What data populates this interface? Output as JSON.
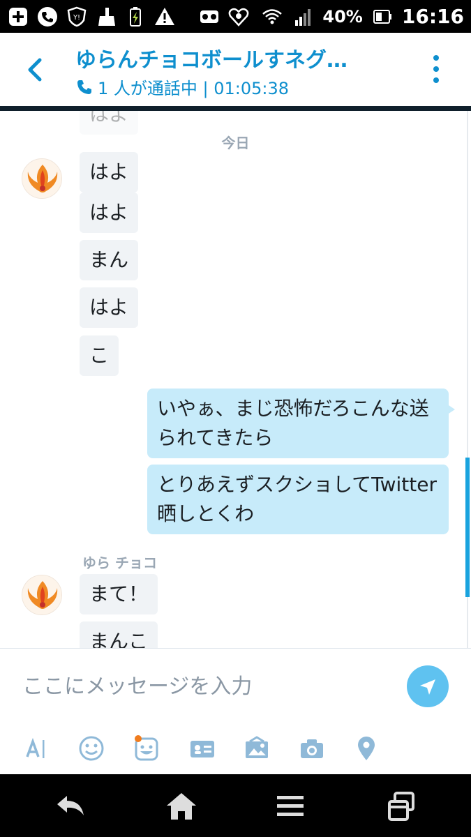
{
  "status_bar": {
    "battery_percent": "40%",
    "time": "16:16",
    "icons": [
      "plus-icon",
      "phone-icon",
      "yahoo-shield-icon",
      "broom-icon",
      "battery-charging-icon",
      "warning-icon",
      "voicemail-icon",
      "heart-icon",
      "wifi-icon",
      "signal-icon",
      "battery-icon"
    ]
  },
  "header": {
    "title": "ゆらんチョコボールすネグ…",
    "call_status": "1 人が通話中 | 01:05:38"
  },
  "chat": {
    "date_divider": "今日",
    "partial_top_message": "はよ",
    "incoming_group_1": [
      "はよ",
      "はよ",
      "まん",
      "はよ",
      "こ"
    ],
    "outgoing": [
      "いやぁ、まじ恐怖だろこんな送られてきたら",
      "とりあえずスクショしてTwitter晒しとくわ"
    ],
    "sender_name": "ゆら チョコ",
    "incoming_group_2": [
      "まて！",
      "まんこ"
    ]
  },
  "composer": {
    "placeholder": "ここにメッセージを入力"
  },
  "colors": {
    "accent": "#0e8fce",
    "outgoing_bubble": "#c7ebfa",
    "incoming_bubble": "#f0f3f6",
    "send_button": "#5fc2f0",
    "notification_dot": "#f07c1e"
  }
}
